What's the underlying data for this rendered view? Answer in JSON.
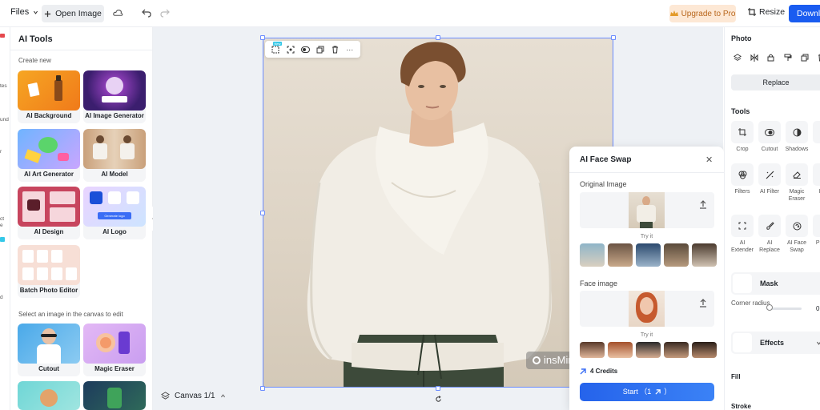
{
  "topbar": {
    "files_label": "Files",
    "open_image_label": "Open Image",
    "upgrade_label": "Upgrade to Pro",
    "resize_label": "Resize",
    "download_label": "Download"
  },
  "rail": {
    "items": [
      "tes",
      "und",
      "r",
      "ct",
      "e",
      "d"
    ]
  },
  "ai_tools": {
    "title": "AI Tools",
    "section_create": "Create new",
    "section_edit": "Select an image in the canvas to edit",
    "cards": [
      {
        "label": "AI Background"
      },
      {
        "label": "AI Image Generator"
      },
      {
        "label": "AI Art Generator"
      },
      {
        "label": "AI Model"
      },
      {
        "label": "AI Design"
      },
      {
        "label": "AI Logo"
      },
      {
        "label": "Batch Photo Editor"
      },
      {
        "label": "Cutout"
      },
      {
        "label": "Magic Eraser"
      }
    ],
    "ai_logo_button_text": "Generate logo"
  },
  "canvas": {
    "watermark_text": "insMind",
    "new_badge": "New",
    "canvas_switch_label": "Canvas 1/1"
  },
  "face_swap": {
    "title": "AI Face Swap",
    "original_label": "Original Image",
    "face_label": "Face image",
    "try_it": "Try it",
    "credits": "4 Credits",
    "start_label": "Start （1",
    "upload_icon": "upload-icon"
  },
  "props": {
    "photo_heading": "Photo",
    "replace_label": "Replace",
    "tools_heading": "Tools",
    "tools": [
      {
        "label": "Crop"
      },
      {
        "label": "Cutout"
      },
      {
        "label": "Shadows"
      },
      {
        "label": "Ad"
      },
      {
        "label": "Filters"
      },
      {
        "label": "AI Filter"
      },
      {
        "label": "Magic Eraser"
      },
      {
        "label": "Enh"
      },
      {
        "label": "AI Extender"
      },
      {
        "label": "AI Replace"
      },
      {
        "label": "AI Face Swap"
      },
      {
        "label": "Pro co"
      }
    ],
    "mask_label": "Mask",
    "corner_radius_label": "Corner radius",
    "corner_radius_value": "0",
    "effects_label": "Effects",
    "fill_label": "Fill",
    "stroke_label": "Stroke"
  },
  "colors": {
    "accent": "#1a5cf0",
    "upgrade_bg": "#fde8d5",
    "upgrade_text": "#b8661c",
    "selection": "#6b8cff"
  }
}
